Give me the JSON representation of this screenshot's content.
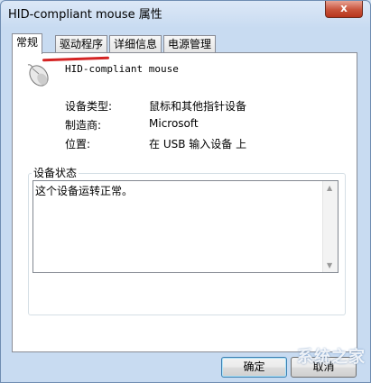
{
  "window": {
    "title": "HID-compliant mouse 属性",
    "close_label": "x"
  },
  "tabs": [
    {
      "label": "常规"
    },
    {
      "label": "驱动程序"
    },
    {
      "label": "详细信息"
    },
    {
      "label": "电源管理"
    }
  ],
  "device": {
    "icon": "mouse-icon",
    "name": "HID-compliant mouse",
    "properties": [
      {
        "label": "设备类型:",
        "value": "鼠标和其他指针设备"
      },
      {
        "label": "制造商:",
        "value": "Microsoft"
      },
      {
        "label": "位置:",
        "value": "在 USB 输入设备 上"
      }
    ]
  },
  "status": {
    "legend": "设备状态",
    "text": "这个设备运转正常。"
  },
  "buttons": {
    "ok": "确定",
    "cancel": "取消"
  },
  "watermark": "系统之家",
  "colors": {
    "annotation_underline": "#d42424"
  }
}
